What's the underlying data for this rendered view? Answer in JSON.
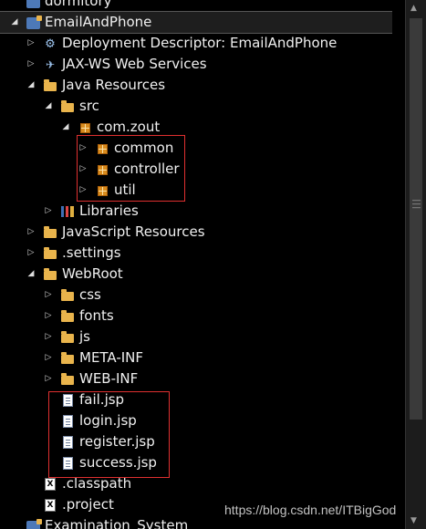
{
  "tree": {
    "items": [
      {
        "label": "dormitory",
        "icon": "project-icon",
        "twisty": ""
      },
      {
        "label": "EmailAndPhone",
        "icon": "project-icon",
        "twisty": "expanded"
      },
      {
        "label": "Deployment Descriptor: EmailAndPhone",
        "icon": "deployment-descriptor-icon",
        "twisty": "collapsed"
      },
      {
        "label": "JAX-WS Web Services",
        "icon": "web-services-icon",
        "twisty": "collapsed"
      },
      {
        "label": "Java Resources",
        "icon": "java-resources-icon",
        "twisty": "expanded"
      },
      {
        "label": "src",
        "icon": "source-folder-icon",
        "twisty": "expanded"
      },
      {
        "label": "com.zout",
        "icon": "package-icon",
        "twisty": "expanded"
      },
      {
        "label": "common",
        "icon": "package-icon",
        "twisty": "collapsed"
      },
      {
        "label": "controller",
        "icon": "package-icon",
        "twisty": "collapsed"
      },
      {
        "label": "util",
        "icon": "package-icon",
        "twisty": "collapsed"
      },
      {
        "label": "Libraries",
        "icon": "libraries-icon",
        "twisty": "collapsed"
      },
      {
        "label": "JavaScript Resources",
        "icon": "javascript-resources-icon",
        "twisty": "collapsed"
      },
      {
        "label": ".settings",
        "icon": "folder-icon",
        "twisty": "collapsed"
      },
      {
        "label": "WebRoot",
        "icon": "folder-icon",
        "twisty": "expanded"
      },
      {
        "label": "css",
        "icon": "folder-icon",
        "twisty": "collapsed"
      },
      {
        "label": "fonts",
        "icon": "folder-icon",
        "twisty": "collapsed"
      },
      {
        "label": "js",
        "icon": "folder-icon",
        "twisty": "collapsed"
      },
      {
        "label": "META-INF",
        "icon": "folder-icon",
        "twisty": "collapsed"
      },
      {
        "label": "WEB-INF",
        "icon": "folder-icon",
        "twisty": "collapsed"
      },
      {
        "label": "fail.jsp",
        "icon": "jsp-file-icon",
        "twisty": ""
      },
      {
        "label": "login.jsp",
        "icon": "jsp-file-icon",
        "twisty": ""
      },
      {
        "label": "register.jsp",
        "icon": "jsp-file-icon",
        "twisty": ""
      },
      {
        "label": "success.jsp",
        "icon": "jsp-file-icon",
        "twisty": ""
      },
      {
        "label": ".classpath",
        "icon": "xml-file-icon",
        "twisty": ""
      },
      {
        "label": ".project",
        "icon": "xml-file-icon",
        "twisty": ""
      },
      {
        "label": "Examination_System",
        "icon": "project-icon",
        "twisty": ""
      }
    ]
  },
  "watermark": "https://blog.csdn.net/ITBigGod",
  "colors": {
    "background": "#000000",
    "text": "#f0f0f0",
    "highlight_box": "#e03030",
    "folder": "#e9b44c",
    "package": "#d98c1e"
  }
}
